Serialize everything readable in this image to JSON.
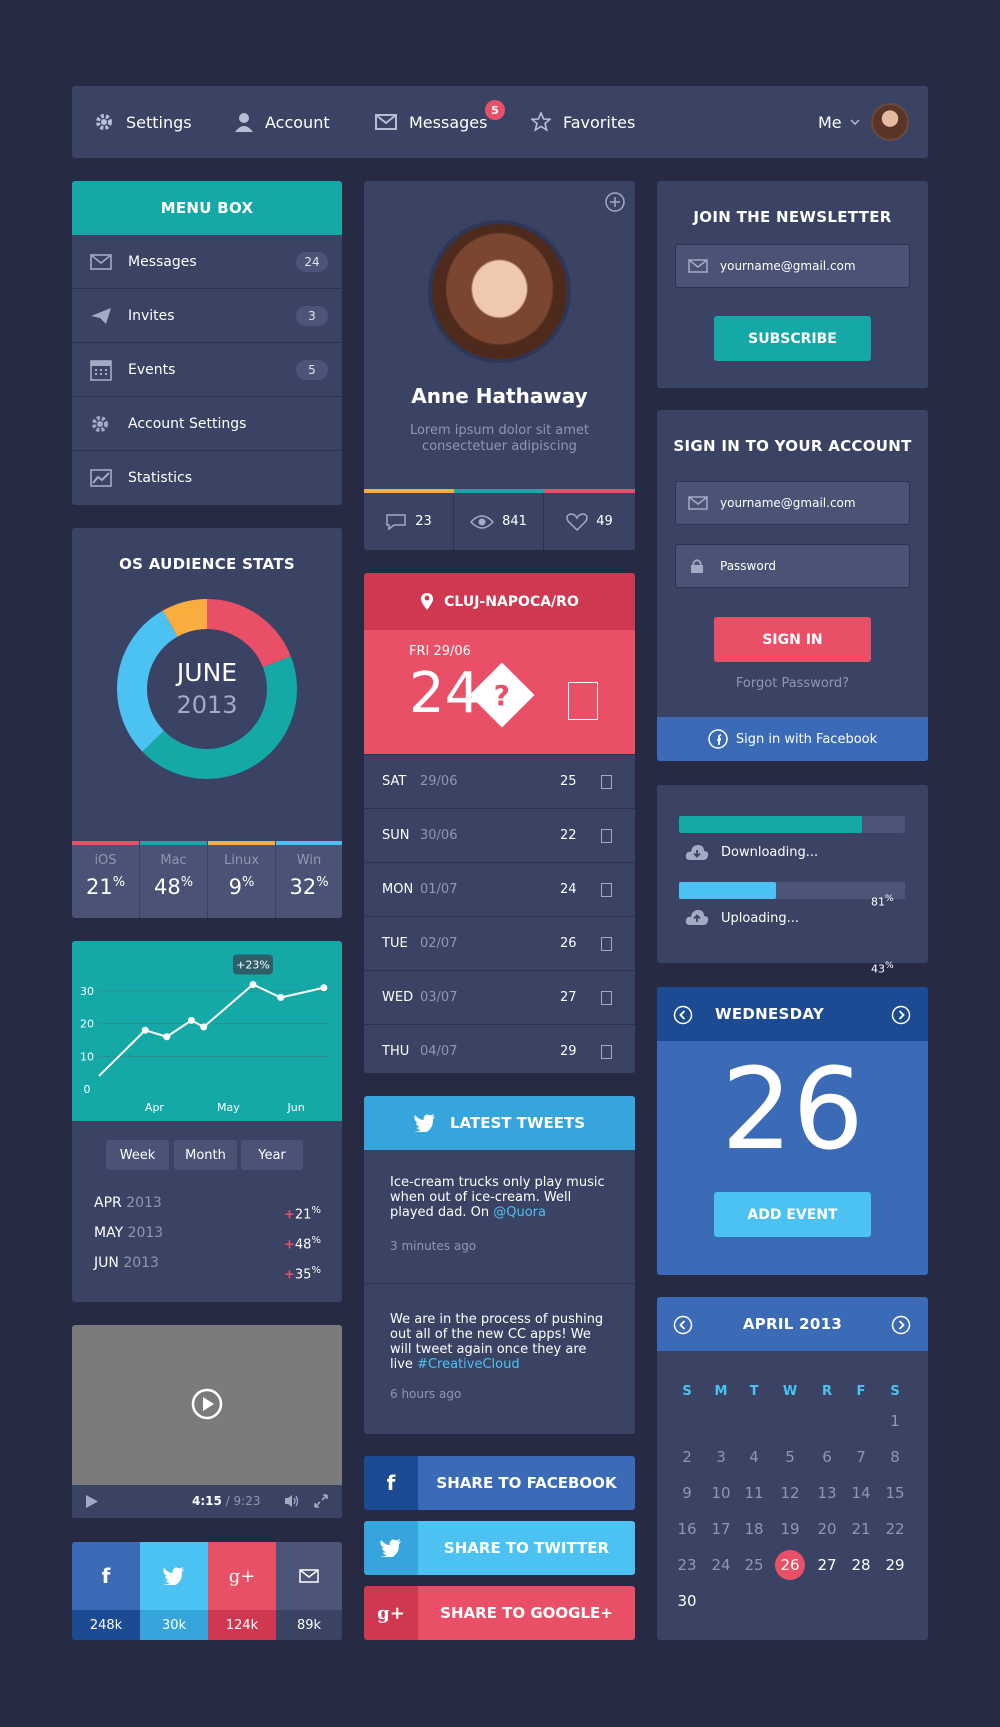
{
  "nav": {
    "settings": "Settings",
    "account": "Account",
    "messages": "Messages",
    "messages_badge": "5",
    "favorites": "Favorites",
    "me": "Me"
  },
  "menu_box": {
    "title": "MENU BOX",
    "items": [
      {
        "label": "Messages",
        "count": "24"
      },
      {
        "label": "Invites",
        "count": "3"
      },
      {
        "label": "Events",
        "count": "5"
      },
      {
        "label": "Account Settings",
        "count": ""
      },
      {
        "label": "Statistics",
        "count": ""
      }
    ]
  },
  "profile": {
    "name": "Anne Hathaway",
    "bio_line1": "Lorem ipsum dolor sit amet",
    "bio_line2": "consectetuer adipiscing",
    "comments": "23",
    "views": "841",
    "likes": "49"
  },
  "newsletter": {
    "title": "JOIN THE NEWSLETTER",
    "email_placeholder": "yourname@gmail.com",
    "subscribe": "SUBSCRIBE"
  },
  "signin": {
    "title": "SIGN IN TO YOUR ACCOUNT",
    "email_placeholder": "yourname@gmail.com",
    "password_placeholder": "Password",
    "button": "SIGN IN",
    "forgot": "Forgot Password?",
    "facebook": "Sign in with Facebook"
  },
  "os_stats": {
    "title": "OS AUDIENCE STATS",
    "month": "JUNE",
    "year": "2013",
    "segments": [
      {
        "name": "iOS",
        "value": "21",
        "color": "#e94f66"
      },
      {
        "name": "Mac",
        "value": "48",
        "color": "#14a8a7"
      },
      {
        "name": "Linux",
        "value": "9",
        "color": "#f9ad40"
      },
      {
        "name": "Win",
        "value": "32",
        "color": "#4bc2f1"
      }
    ],
    "pct": "%"
  },
  "weather": {
    "location": "CLUJ-NAPOCA/RO",
    "today_date": "FRI 29/06",
    "today_temp": "24",
    "days": [
      {
        "day": "SAT",
        "date": "29/06",
        "temp": "25"
      },
      {
        "day": "SUN",
        "date": "30/06",
        "temp": "22"
      },
      {
        "day": "MON",
        "date": "01/07",
        "temp": "24"
      },
      {
        "day": "TUE",
        "date": "02/07",
        "temp": "26"
      },
      {
        "day": "WED",
        "date": "03/07",
        "temp": "27"
      },
      {
        "day": "THU",
        "date": "04/07",
        "temp": "29"
      }
    ]
  },
  "progress": {
    "download_label": "Downloading...",
    "download_value": 81,
    "download_pct": "81",
    "upload_label": "Uploading...",
    "upload_value": 43,
    "upload_pct": "43",
    "pct": "%"
  },
  "chart_data": {
    "type": "line",
    "x": [
      0.0,
      1.5,
      2.2,
      3.0,
      3.4,
      5.0,
      5.9,
      7.3
    ],
    "y": [
      4,
      18,
      16,
      21,
      19,
      32,
      28,
      31
    ],
    "ylim": [
      0,
      30
    ],
    "yticks": [
      "0",
      "10",
      "20",
      "30"
    ],
    "xticks": [
      "Apr",
      "May",
      "Jun"
    ],
    "tooltip": "+23%",
    "color": "#14a8a7"
  },
  "chart_panel": {
    "tabs": [
      "Week",
      "Month",
      "Year"
    ],
    "stats": [
      {
        "month": "APR",
        "year": "2013",
        "plus": "+",
        "value": "21",
        "pct": "%"
      },
      {
        "month": "MAY",
        "year": "2013",
        "plus": "+",
        "value": "48",
        "pct": "%"
      },
      {
        "month": "JUN",
        "year": "2013",
        "plus": "+",
        "value": "35",
        "pct": "%"
      }
    ]
  },
  "day_widget": {
    "weekday": "WEDNESDAY",
    "day": "26",
    "add_event": "ADD EVENT"
  },
  "tweets": {
    "title": "LATEST TWEETS",
    "items": [
      {
        "text": "Ice-cream trucks only play music when out of ice-cream. Well played dad. On ",
        "link": "@Quora",
        "time": "3 minutes ago"
      },
      {
        "text": "We are in the process of pushing out all of the new CC apps! We will tweet again once they are live ",
        "link": "#CreativeCloud",
        "time": "6 hours ago"
      }
    ]
  },
  "video": {
    "current": "4:15",
    "separator": " / ",
    "total": "9:23"
  },
  "calendar": {
    "title": "APRIL 2013",
    "weekdays": [
      "S",
      "M",
      "T",
      "W",
      "R",
      "F",
      "S"
    ],
    "days": [
      "1",
      "2",
      "3",
      "4",
      "5",
      "6",
      "7",
      "8",
      "9",
      "10",
      "11",
      "12",
      "13",
      "14",
      "15",
      "16",
      "17",
      "18",
      "19",
      "20",
      "21",
      "22",
      "23",
      "24",
      "25",
      "26",
      "27",
      "28",
      "29",
      "30"
    ],
    "selected": "26"
  },
  "share": {
    "facebook": "SHARE TO FACEBOOK",
    "twitter": "SHARE TO TWITTER",
    "google": "SHARE TO GOOGLE+"
  },
  "social_counts": {
    "facebook": "248k",
    "twitter": "30k",
    "google": "124k",
    "mail": "89k"
  },
  "colors": {
    "bg": "#262b43",
    "card": "#3a4364",
    "teal": "#14a8a7",
    "red": "#e94f66",
    "blue": "#3b6bb7",
    "sky": "#4bc2f1"
  }
}
